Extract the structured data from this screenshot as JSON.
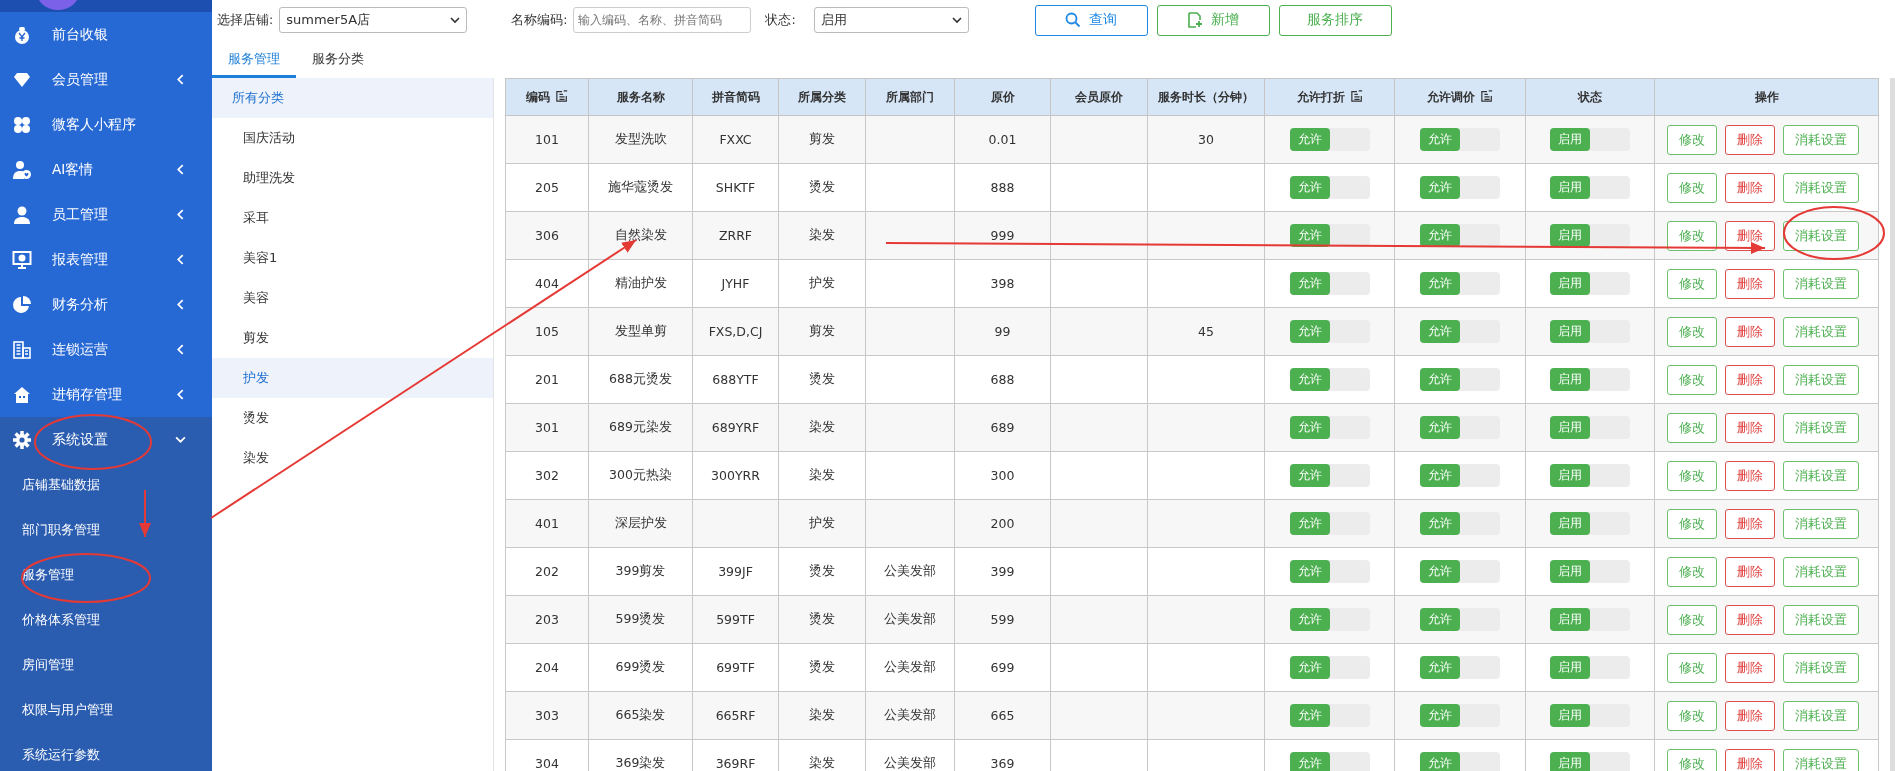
{
  "sidebar": {
    "items": [
      {
        "label": "前台收银",
        "expandable": false,
        "expanded": false
      },
      {
        "label": "会员管理",
        "expandable": true,
        "expanded": false
      },
      {
        "label": "微客人小程序",
        "expandable": false,
        "expanded": false
      },
      {
        "label": "AI客情",
        "expandable": true,
        "expanded": false
      },
      {
        "label": "员工管理",
        "expandable": true,
        "expanded": false
      },
      {
        "label": "报表管理",
        "expandable": true,
        "expanded": false
      },
      {
        "label": "财务分析",
        "expandable": true,
        "expanded": false
      },
      {
        "label": "连锁运营",
        "expandable": true,
        "expanded": false
      },
      {
        "label": "进销存管理",
        "expandable": true,
        "expanded": false
      },
      {
        "label": "系统设置",
        "expandable": true,
        "expanded": true,
        "children": [
          {
            "label": "店铺基础数据"
          },
          {
            "label": "部门职务管理"
          },
          {
            "label": "服务管理"
          },
          {
            "label": "价格体系管理"
          },
          {
            "label": "房间管理"
          },
          {
            "label": "权限与用户管理"
          },
          {
            "label": "系统运行参数"
          }
        ]
      }
    ]
  },
  "filters": {
    "store_label": "选择店铺:",
    "store_value": "summer5A店",
    "name_label": "名称编码:",
    "name_placeholder": "输入编码、名称、拼音简码",
    "status_label": "状态:",
    "status_value": "启用"
  },
  "toolbar_buttons": [
    {
      "label": "查询",
      "kind": "search"
    },
    {
      "label": "新增",
      "kind": "add"
    },
    {
      "label": "服务排序",
      "kind": "sort"
    }
  ],
  "tabs": [
    {
      "label": "服务管理",
      "selected": true
    },
    {
      "label": "服务分类",
      "selected": false
    }
  ],
  "categories": {
    "root": "所有分类",
    "items": [
      {
        "label": "国庆活动",
        "selected": false
      },
      {
        "label": "助理洗发",
        "selected": false
      },
      {
        "label": "采耳",
        "selected": false
      },
      {
        "label": "美容1",
        "selected": false
      },
      {
        "label": "美容",
        "selected": false
      },
      {
        "label": "剪发",
        "selected": false
      },
      {
        "label": "护发",
        "selected": true
      },
      {
        "label": "烫发",
        "selected": false
      },
      {
        "label": "染发",
        "selected": false
      }
    ]
  },
  "table": {
    "columns": [
      {
        "label": "编码",
        "has_edit_icon": true
      },
      {
        "label": "服务名称",
        "has_edit_icon": false
      },
      {
        "label": "拼音简码",
        "has_edit_icon": false
      },
      {
        "label": "所属分类",
        "has_edit_icon": false
      },
      {
        "label": "所属部门",
        "has_edit_icon": false
      },
      {
        "label": "原价",
        "has_edit_icon": false
      },
      {
        "label": "会员原价",
        "has_edit_icon": false
      },
      {
        "label": "服务时长（分钟）",
        "has_edit_icon": false
      },
      {
        "label": "允许打折",
        "has_edit_icon": true
      },
      {
        "label": "允许调价",
        "has_edit_icon": true
      },
      {
        "label": "状态",
        "has_edit_icon": false
      },
      {
        "label": "操作",
        "has_edit_icon": false
      }
    ],
    "rows": [
      {
        "code": "101",
        "name": "发型洗吹",
        "pinyin": "FXXC",
        "category": "剪发",
        "price": "0.01",
        "duration": "30",
        "toggles": [
          {
            "label": "允许",
            "on": true
          },
          {
            "label": "允许",
            "on": true
          },
          {
            "label": "启用",
            "on": true
          }
        ],
        "actions": [
          {
            "label": "修改",
            "kind": "edit"
          },
          {
            "label": "删除",
            "kind": "delete"
          },
          {
            "label": "消耗设置",
            "kind": "consume"
          }
        ]
      },
      {
        "code": "205",
        "name": "施华蔻烫发",
        "pinyin": "SHKTF",
        "category": "烫发",
        "price": "888",
        "toggles": [
          {
            "label": "允许",
            "on": true
          },
          {
            "label": "允许",
            "on": true
          },
          {
            "label": "启用",
            "on": true
          }
        ],
        "actions": [
          {
            "label": "修改",
            "kind": "edit"
          },
          {
            "label": "删除",
            "kind": "delete"
          },
          {
            "label": "消耗设置",
            "kind": "consume"
          }
        ]
      },
      {
        "code": "306",
        "name": "自然染发",
        "pinyin": "ZRRF",
        "category": "染发",
        "price": "999",
        "toggles": [
          {
            "label": "允许",
            "on": true
          },
          {
            "label": "允许",
            "on": true
          },
          {
            "label": "启用",
            "on": true
          }
        ],
        "actions": [
          {
            "label": "修改",
            "kind": "edit"
          },
          {
            "label": "删除",
            "kind": "delete"
          },
          {
            "label": "消耗设置",
            "kind": "consume"
          }
        ]
      },
      {
        "code": "404",
        "name": "精油护发",
        "pinyin": "JYHF",
        "category": "护发",
        "price": "398",
        "toggles": [
          {
            "label": "允许",
            "on": true
          },
          {
            "label": "允许",
            "on": true
          },
          {
            "label": "启用",
            "on": true
          }
        ],
        "actions": [
          {
            "label": "修改",
            "kind": "edit"
          },
          {
            "label": "删除",
            "kind": "delete"
          },
          {
            "label": "消耗设置",
            "kind": "consume"
          }
        ]
      },
      {
        "code": "105",
        "name": "发型单剪",
        "pinyin": "FXS,D,CJ",
        "category": "剪发",
        "price": "99",
        "duration": "45",
        "toggles": [
          {
            "label": "允许",
            "on": true
          },
          {
            "label": "允许",
            "on": true
          },
          {
            "label": "启用",
            "on": true
          }
        ],
        "actions": [
          {
            "label": "修改",
            "kind": "edit"
          },
          {
            "label": "删除",
            "kind": "delete"
          },
          {
            "label": "消耗设置",
            "kind": "consume"
          }
        ]
      },
      {
        "code": "201",
        "name": "688元烫发",
        "pinyin": "688YTF",
        "category": "烫发",
        "price": "688",
        "toggles": [
          {
            "label": "允许",
            "on": true
          },
          {
            "label": "允许",
            "on": true
          },
          {
            "label": "启用",
            "on": true
          }
        ],
        "actions": [
          {
            "label": "修改",
            "kind": "edit"
          },
          {
            "label": "删除",
            "kind": "delete"
          },
          {
            "label": "消耗设置",
            "kind": "consume"
          }
        ]
      },
      {
        "code": "301",
        "name": "689元染发",
        "pinyin": "689YRF",
        "category": "染发",
        "price": "689",
        "toggles": [
          {
            "label": "允许",
            "on": true
          },
          {
            "label": "允许",
            "on": true
          },
          {
            "label": "启用",
            "on": true
          }
        ],
        "actions": [
          {
            "label": "修改",
            "kind": "edit"
          },
          {
            "label": "删除",
            "kind": "delete"
          },
          {
            "label": "消耗设置",
            "kind": "consume"
          }
        ]
      },
      {
        "code": "302",
        "name": "300元热染",
        "pinyin": "300YRR",
        "category": "染发",
        "price": "300",
        "toggles": [
          {
            "label": "允许",
            "on": true
          },
          {
            "label": "允许",
            "on": true
          },
          {
            "label": "启用",
            "on": true
          }
        ],
        "actions": [
          {
            "label": "修改",
            "kind": "edit"
          },
          {
            "label": "删除",
            "kind": "delete"
          },
          {
            "label": "消耗设置",
            "kind": "consume"
          }
        ]
      },
      {
        "code": "401",
        "name": "深层护发",
        "category": "护发",
        "price": "200",
        "toggles": [
          {
            "label": "允许",
            "on": true
          },
          {
            "label": "允许",
            "on": true
          },
          {
            "label": "启用",
            "on": true
          }
        ],
        "actions": [
          {
            "label": "修改",
            "kind": "edit"
          },
          {
            "label": "删除",
            "kind": "delete"
          },
          {
            "label": "消耗设置",
            "kind": "consume"
          }
        ]
      },
      {
        "code": "202",
        "name": "399剪发",
        "pinyin": "399JF",
        "category": "烫发",
        "department": "公美发部",
        "price": "399",
        "toggles": [
          {
            "label": "允许",
            "on": true
          },
          {
            "label": "允许",
            "on": true
          },
          {
            "label": "启用",
            "on": true
          }
        ],
        "actions": [
          {
            "label": "修改",
            "kind": "edit"
          },
          {
            "label": "删除",
            "kind": "delete"
          },
          {
            "label": "消耗设置",
            "kind": "consume"
          }
        ]
      },
      {
        "code": "203",
        "name": "599烫发",
        "pinyin": "599TF",
        "category": "烫发",
        "department": "公美发部",
        "price": "599",
        "toggles": [
          {
            "label": "允许",
            "on": true
          },
          {
            "label": "允许",
            "on": true
          },
          {
            "label": "启用",
            "on": true
          }
        ],
        "actions": [
          {
            "label": "修改",
            "kind": "edit"
          },
          {
            "label": "删除",
            "kind": "delete"
          },
          {
            "label": "消耗设置",
            "kind": "consume"
          }
        ]
      },
      {
        "code": "204",
        "name": "699烫发",
        "pinyin": "699TF",
        "category": "烫发",
        "department": "公美发部",
        "price": "699",
        "toggles": [
          {
            "label": "允许",
            "on": true
          },
          {
            "label": "允许",
            "on": true
          },
          {
            "label": "启用",
            "on": true
          }
        ],
        "actions": [
          {
            "label": "修改",
            "kind": "edit"
          },
          {
            "label": "删除",
            "kind": "delete"
          },
          {
            "label": "消耗设置",
            "kind": "consume"
          }
        ]
      },
      {
        "code": "303",
        "name": "665染发",
        "pinyin": "665RF",
        "category": "染发",
        "department": "公美发部",
        "price": "665",
        "toggles": [
          {
            "label": "允许",
            "on": true
          },
          {
            "label": "允许",
            "on": true
          },
          {
            "label": "启用",
            "on": true
          }
        ],
        "actions": [
          {
            "label": "修改",
            "kind": "edit"
          },
          {
            "label": "删除",
            "kind": "delete"
          },
          {
            "label": "消耗设置",
            "kind": "consume"
          }
        ]
      },
      {
        "code": "304",
        "name": "369染发",
        "pinyin": "369RF",
        "category": "染发",
        "department": "公美发部",
        "price": "369",
        "toggles": [
          {
            "label": "允许",
            "on": true
          },
          {
            "label": "允许",
            "on": true
          },
          {
            "label": "启用",
            "on": true
          }
        ],
        "actions": [
          {
            "label": "修改",
            "kind": "edit"
          },
          {
            "label": "删除",
            "kind": "delete"
          },
          {
            "label": "消耗设置",
            "kind": "consume"
          }
        ]
      }
    ]
  }
}
